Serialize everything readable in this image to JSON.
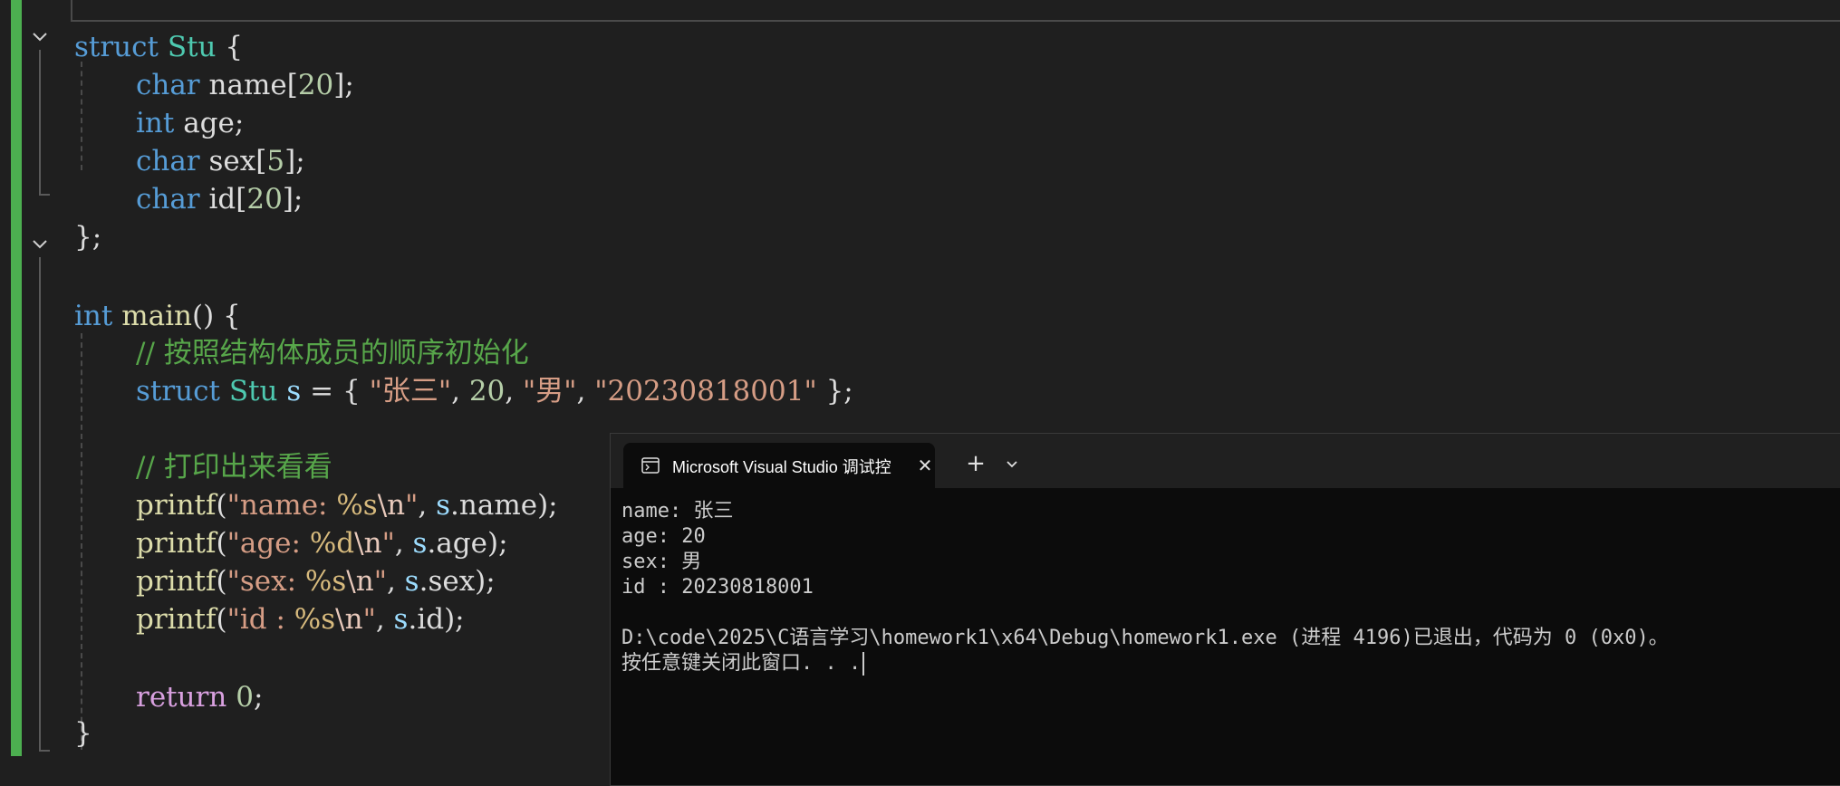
{
  "editor": {
    "lines": {
      "l1": {
        "kw": "struct",
        "name": "Stu",
        "brace": "{"
      },
      "l2": {
        "type": "char",
        "name": "name",
        "lb": "[",
        "num": "20",
        "rb": "];"
      },
      "l3": {
        "type": "int",
        "name": "age;"
      },
      "l4": {
        "type": "char",
        "name": "sex",
        "lb": "[",
        "num": "5",
        "rb": "];"
      },
      "l5": {
        "type": "char",
        "name": "id",
        "lb": "[",
        "num": "20",
        "rb": "];"
      },
      "l6": {
        "text": "};"
      },
      "l7": {
        "type": "int",
        "fn": "main",
        "rest": "() {"
      },
      "l8": {
        "comment": "// 按照结构体成员的顺序初始化"
      },
      "l9": {
        "kw": "struct",
        "type": "Stu",
        "var": "s",
        "eq": " = { ",
        "s1": "\"张三\"",
        "c1": ", ",
        "n1": "20",
        "c2": ", ",
        "s2": "\"男\"",
        "c3": ", ",
        "s3": "\"20230818001\"",
        "end": " };"
      },
      "l10": {
        "comment": "// 打印出来看看"
      },
      "l11": {
        "fn": "printf",
        "open": "(",
        "s_a": "\"name: ",
        "fmt": "%s",
        "esc": "\\n",
        "s_b": "\"",
        "mid": ", ",
        "var": "s",
        "mem": ".name);"
      },
      "l12": {
        "fn": "printf",
        "open": "(",
        "s_a": "\"age: ",
        "fmt": "%d",
        "esc": "\\n",
        "s_b": "\"",
        "mid": ", ",
        "var": "s",
        "mem": ".age);"
      },
      "l13": {
        "fn": "printf",
        "open": "(",
        "s_a": "\"sex: ",
        "fmt": "%s",
        "esc": "\\n",
        "s_b": "\"",
        "mid": ", ",
        "var": "s",
        "mem": ".sex);"
      },
      "l14": {
        "fn": "printf",
        "open": "(",
        "s_a": "\"id : ",
        "fmt": "%s",
        "esc": "\\n",
        "s_b": "\"",
        "mid": ", ",
        "var": "s",
        "mem": ".id);"
      },
      "l15": {
        "kw": "return",
        "num": "0",
        "end": ";"
      },
      "l16": {
        "text": "}"
      }
    }
  },
  "console": {
    "tab_title": "Microsoft Visual Studio 调试控",
    "tab_icon": "terminal-icon",
    "close_glyph": "✕",
    "plus_glyph": "+",
    "dropdown_icon": "chevron-down-icon",
    "output": {
      "line1": "name: 张三",
      "line2": "age: 20",
      "line3": "sex: 男",
      "line4": "id : 20230818001",
      "line5": "D:\\code\\2025\\C语言学习\\homework1\\x64\\Debug\\homework1.exe (进程 4196)已退出，代码为 0 (0x0)。",
      "line6": "按任意键关闭此窗口. . ."
    }
  },
  "colors": {
    "editor_bg": "#1f1f1f",
    "keyword": "#569cd6",
    "type": "#4ec9b0",
    "string": "#d69d85",
    "comment": "#57a64a",
    "function": "#dcdcaa",
    "number": "#b5cea8",
    "change_bar": "#4caf50",
    "console_bg": "#0c0c0c"
  }
}
